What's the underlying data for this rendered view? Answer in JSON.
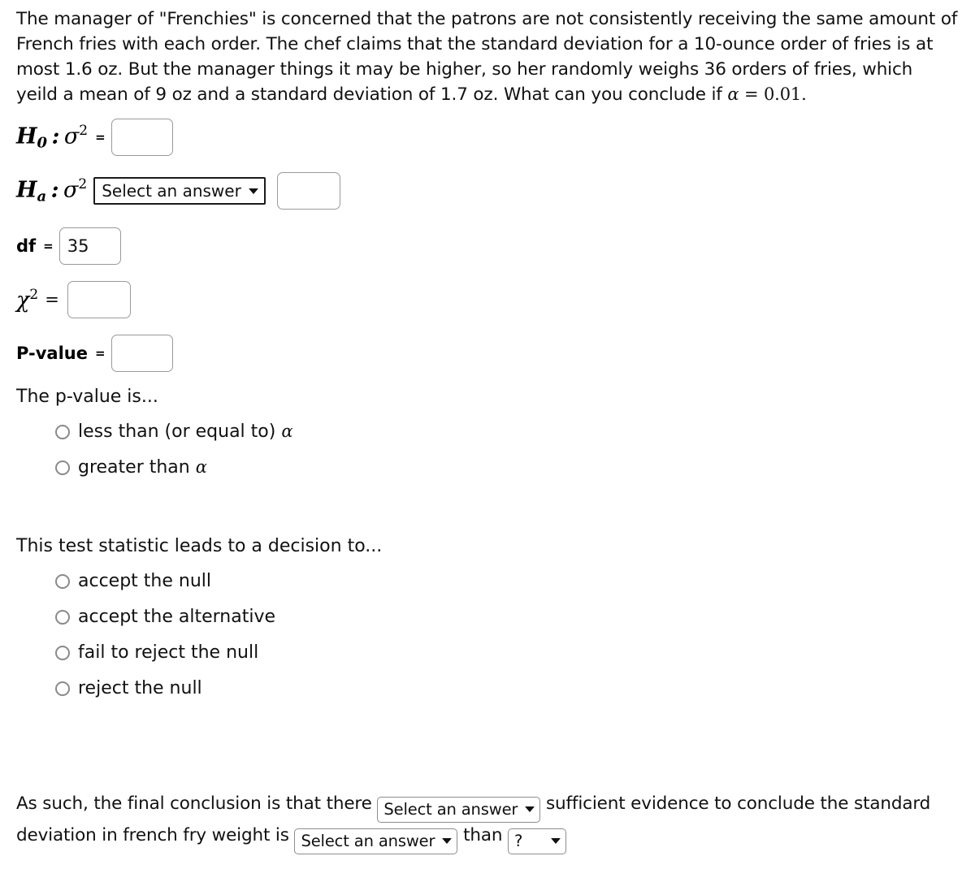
{
  "problem": {
    "text_part1": "The manager of \"Frenchies\" is concerned that the patrons are not consistently receiving the same amount of French fries with each order. The chef claims that the standard deviation for a 10-ounce order of fries is at most 1.6 oz. But the manager things it may be higher, so her randomly weighs 36 orders of fries, which yeild a mean of 9 oz and a standard deviation of 1.7 oz. What can you conclude if ",
    "alpha_symbol": "α",
    "equals": "=",
    "alpha_value": "0.01.",
    "restaurant": "Frenchies",
    "claimed_sd": "1.6 oz",
    "sample_size": "36",
    "sample_mean": "9 oz",
    "sample_sd": "1.7 oz",
    "significance_level": "0.01"
  },
  "null_hypothesis": {
    "label_H": "H",
    "label_sub": "0",
    "label_colon": ":",
    "label_sigma": "σ",
    "label_sup": "2",
    "operator": "=",
    "input_value": "",
    "input_placeholder": ""
  },
  "alt_hypothesis": {
    "label_H": "H",
    "label_sub": "a",
    "label_colon": ":",
    "label_sigma": "σ",
    "label_sup": "2",
    "select_value": "Select an answer",
    "chevron": "⌄",
    "input_value": "",
    "input_placeholder": ""
  },
  "df_row": {
    "label": "df",
    "operator": "=",
    "input_value": "35"
  },
  "chi_row": {
    "label_chi": "χ",
    "label_sup": "2",
    "operator": "=",
    "input_value": "",
    "input_placeholder": ""
  },
  "pvalue_row": {
    "label": "P-value",
    "operator": "=",
    "input_value": "",
    "input_placeholder": ""
  },
  "pvalue_question": {
    "prompt": "The p-value is...",
    "options": [
      {
        "text_before": "less than (or equal to) ",
        "alpha": "α",
        "selected": false
      },
      {
        "text_before": "greater than ",
        "alpha": "α",
        "selected": false
      }
    ]
  },
  "decision_question": {
    "prompt": "This test statistic leads to a decision to...",
    "options": [
      {
        "text_before": "accept the null",
        "alpha": "",
        "selected": false
      },
      {
        "text_before": "accept the alternative",
        "alpha": "",
        "selected": false
      },
      {
        "text_before": "fail to reject the null",
        "alpha": "",
        "selected": false
      },
      {
        "text_before": "reject the null",
        "alpha": "",
        "selected": false
      }
    ]
  },
  "conclusion": {
    "text_1": "As such, the final conclusion is that there",
    "select_1_value": "Select an answer",
    "text_2": "sufficient evidence to conclude the standard deviation in french fry weight is",
    "select_2_value": "Select an answer",
    "text_3": "than",
    "select_3_value": "?",
    "chevron": "⌄"
  }
}
